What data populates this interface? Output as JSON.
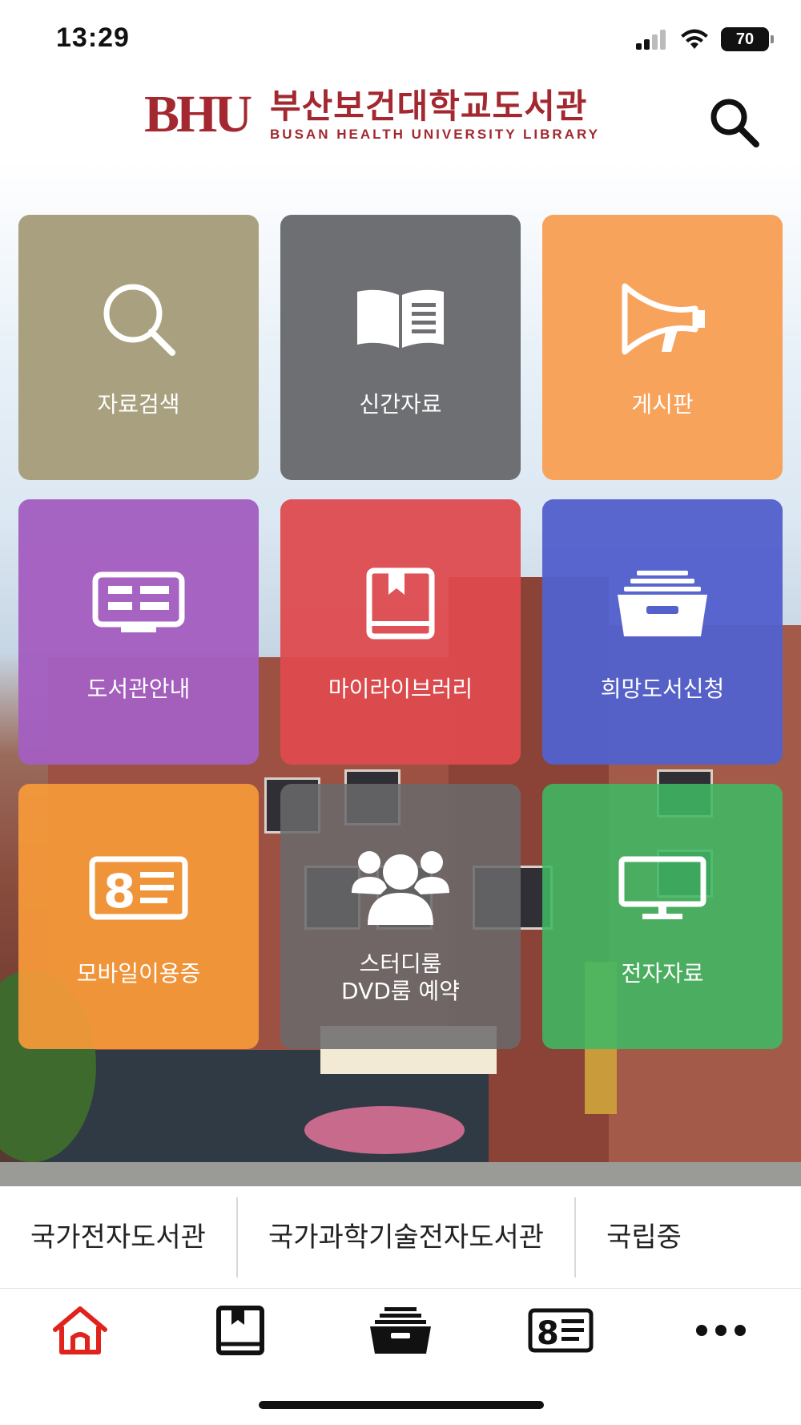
{
  "status_bar": {
    "time": "13:29",
    "battery": "70",
    "icons": [
      "cellular-signal-icon",
      "wifi-icon",
      "battery-icon"
    ]
  },
  "header": {
    "logo_mark": "BHU",
    "logo_title": "부산보건대학교도서관",
    "logo_subtitle": "BUSAN HEALTH UNIVERSITY LIBRARY",
    "search_icon": "search-icon",
    "brand_color": "#a3282f"
  },
  "tiles": [
    {
      "label": "자료검색",
      "icon": "search-icon",
      "color": "#a8a07e"
    },
    {
      "label": "신간자료",
      "icon": "open-book-icon",
      "color": "#6e6f72"
    },
    {
      "label": "게시판",
      "icon": "megaphone-icon",
      "color": "#f7a35c"
    },
    {
      "label": "도서관안내",
      "icon": "monitor-info-icon",
      "color": "#a45fc0"
    },
    {
      "label": "마이라이브러리",
      "icon": "bookmark-book-icon",
      "color": "#de4b4f"
    },
    {
      "label": "희망도서신청",
      "icon": "file-drawer-icon",
      "color": "#5461cc"
    },
    {
      "label": "모바일이용증",
      "icon": "id-card-icon",
      "color": "#f79a3a"
    },
    {
      "label": "스터디룸\nDVD룸 예약",
      "icon": "group-icon",
      "color": "#6a6a6c"
    },
    {
      "label": "전자자료",
      "icon": "desktop-icon",
      "color": "#3fb863"
    }
  ],
  "quick_links": [
    "국가전자도서관",
    "국가과학기술전자도서관",
    "국립중"
  ],
  "tab_bar": [
    {
      "name": "home",
      "icon": "home-icon",
      "active": true,
      "color": "#e0231c"
    },
    {
      "name": "book",
      "icon": "bookmark-book-icon",
      "active": false,
      "color": "#111111"
    },
    {
      "name": "drawer",
      "icon": "file-drawer-icon",
      "active": false,
      "color": "#111111"
    },
    {
      "name": "card",
      "icon": "id-card-icon",
      "active": false,
      "color": "#111111"
    },
    {
      "name": "more",
      "icon": "more-icon",
      "active": false,
      "color": "#111111"
    }
  ]
}
